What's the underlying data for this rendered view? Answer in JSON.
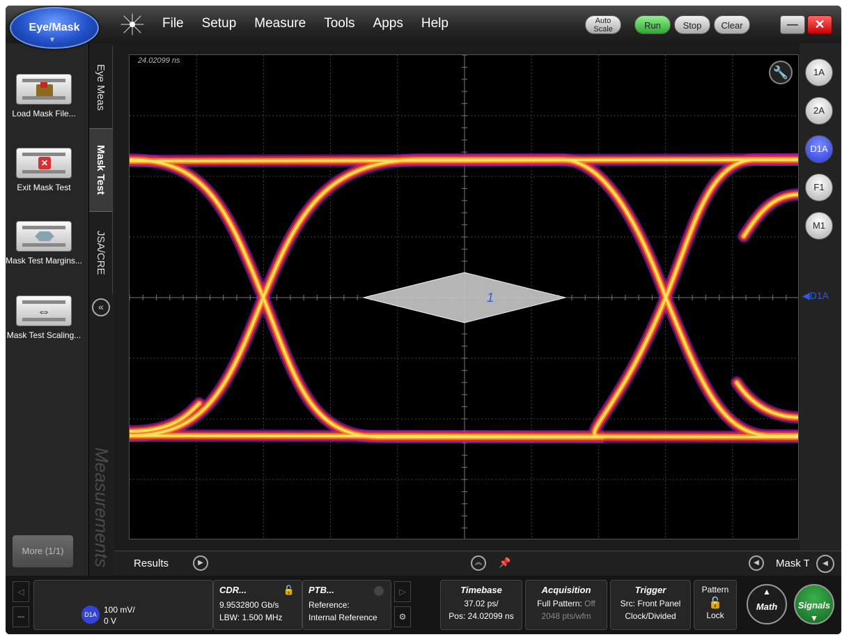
{
  "app": {
    "mode_button": "Eye/Mask",
    "menu": [
      "File",
      "Setup",
      "Measure",
      "Tools",
      "Apps",
      "Help"
    ],
    "controls": {
      "auto_scale": "Auto Scale",
      "run": "Run",
      "stop": "Stop",
      "clear": "Clear"
    },
    "colors": {
      "run_green": "#2ea82e",
      "close_red": "#cc0000",
      "trace_core": "#ffdd55",
      "trace_edge": "#cc33cc",
      "mask_fill": "#bfbfbf",
      "channel_active": "#2a3ad8"
    }
  },
  "left_panel": {
    "items": [
      {
        "label": "Load Mask File...",
        "icon": "folder-icon"
      },
      {
        "label": "Exit Mask Test",
        "icon": "exit-x-icon"
      },
      {
        "label": "Mask Test Margins...",
        "icon": "hexagon-mask-icon"
      },
      {
        "label": "Mask Test Scaling...",
        "icon": "scale-arrows-icon"
      }
    ],
    "more": "More (1/1)",
    "tabs": [
      "Eye Meas",
      "Mask Test",
      "JSA/CRE"
    ],
    "active_tab": "Mask Test",
    "watermark": "Measurements"
  },
  "display": {
    "timestamp": "24.02099 ns",
    "mask_label": "1",
    "channel_marker": "D1A"
  },
  "channels": [
    "1A",
    "2A",
    "D1A",
    "F1",
    "M1"
  ],
  "active_channel": "D1A",
  "results_bar": {
    "label": "Results",
    "right_label": "Mask Test"
  },
  "status": {
    "channel": {
      "badge": "D1A",
      "scale": "100 mV/",
      "offset": "0 V"
    },
    "cdr": {
      "title": "CDR...",
      "rate": "9.9532800 Gb/s",
      "lbw": "LBW: 1.500 MHz"
    },
    "ptb": {
      "title": "PTB...",
      "line1": "Reference:",
      "line2": "Internal Reference"
    },
    "timebase": {
      "title": "Timebase",
      "scale": "37.02 ps/",
      "pos": "Pos: 24.02099 ns"
    },
    "acquisition": {
      "title": "Acquisition",
      "mode": "Full Pattern: ",
      "mode_state": "Off",
      "pts": "2048 pts/wfm"
    },
    "trigger": {
      "title": "Trigger",
      "src_label": "Src: ",
      "src": "Front Panel",
      "line2": "Clock/Divided"
    },
    "pattern": {
      "title": "Pattern",
      "lock": "Lock"
    },
    "math": "Math",
    "signals": "Signals"
  }
}
